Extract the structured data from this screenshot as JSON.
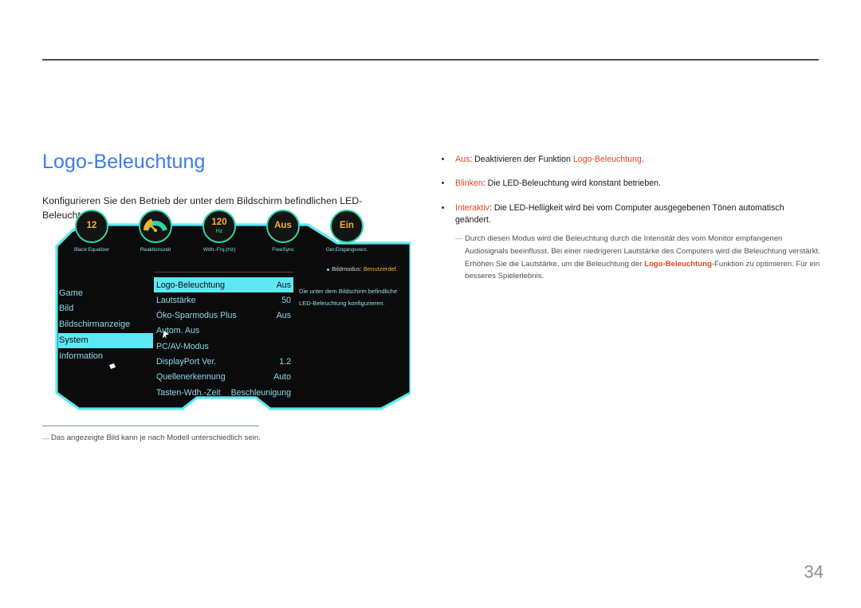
{
  "page": {
    "number": "34",
    "title": "Logo-Beleuchtung",
    "intro": "Konfigurieren Sie den Betrieb der unter dem Bildschirm befindlichen LED-Beleuchtung.",
    "footnote_marker": "―",
    "footnote": "Das angezeigte Bild kann je nach Modell unterschiedlich sein."
  },
  "osd": {
    "dials": [
      {
        "value": "12",
        "unit": "",
        "label": "Black Equalizer",
        "icon": "value-dial-icon"
      },
      {
        "value": "",
        "unit": "",
        "label": "Reaktionszeit",
        "icon": "gauge-dial-icon"
      },
      {
        "value": "120",
        "unit": "Hz",
        "label": "Wdh.-Frq.(Hz)",
        "icon": "value-dial-icon"
      },
      {
        "value": "Aus",
        "unit": "",
        "label": "FreeSync",
        "icon": "value-dial-icon"
      },
      {
        "value": "Ein",
        "unit": "",
        "label": "Ger.Eingangsverz.",
        "icon": "value-dial-icon"
      }
    ],
    "nav": [
      {
        "label": "Game",
        "active": false
      },
      {
        "label": "Bild",
        "active": false
      },
      {
        "label": "Bildschirmanzeige",
        "active": false
      },
      {
        "label": "System",
        "active": true
      },
      {
        "label": "Information",
        "active": false
      }
    ],
    "rows": [
      {
        "key": "Logo-Beleuchtung",
        "value": "Aus",
        "active": true
      },
      {
        "key": "Lautstärke",
        "value": "50",
        "active": false
      },
      {
        "key": "Öko-Sparmodus Plus",
        "value": "Aus",
        "active": false
      },
      {
        "key": "Autom. Aus",
        "value": "",
        "active": false
      },
      {
        "key": "PC/AV-Modus",
        "value": "",
        "active": false
      },
      {
        "key": "DisplayPort Ver.",
        "value": "1.2",
        "active": false
      },
      {
        "key": "Quellenerkennung",
        "value": "Auto",
        "active": false
      },
      {
        "key": "Tasten-Wdh.-Zeit",
        "value": "Beschleunigung",
        "active": false
      }
    ],
    "info": {
      "status_label": "Bildmodus:",
      "status_value": "Benutzerdef.",
      "description": "Die unter dem Bildschirm befindliche LED-Beleuchtung konfigurieren."
    },
    "colors": {
      "cyan": "#5ee8f5",
      "panel": "#0b0b0b",
      "dial_ring": "#2fd6a8",
      "dial_value": "#f0b429"
    }
  },
  "options": [
    {
      "term": "Aus",
      "text_before": ": Deaktivieren der Funktion ",
      "emphasis": "Logo-Beleuchtung",
      "text_after": "."
    },
    {
      "term": "Blinken",
      "text_before": ": Die LED-Beleuchtung wird konstant betrieben.",
      "emphasis": "",
      "text_after": ""
    },
    {
      "term": "Interaktiv",
      "text_before": ": Die LED-Helligkeit wird bei vom Computer ausgegebenen Tönen automatisch geändert.",
      "emphasis": "",
      "text_after": ""
    }
  ],
  "subnote": {
    "marker": "―",
    "part1": "Durch diesen Modus wird die Beleuchtung durch die Intensität des vom Monitor empfangenen Audiosignals beeinflusst. Bei einer niedrigeren Lautstärke des Computers wird die Beleuchtung verstärkt. Erhöhen Sie die Lautstärke, um die Beleuchtung der ",
    "emphasis": "Logo-Beleuchtung",
    "part2": "-Funktion zu optimieren. Für ein besseres Spielerlebnis."
  },
  "theme": {
    "title_color": "#3b7de8",
    "accent_color": "#e0471f",
    "rule_color": "#4d4d4d"
  }
}
